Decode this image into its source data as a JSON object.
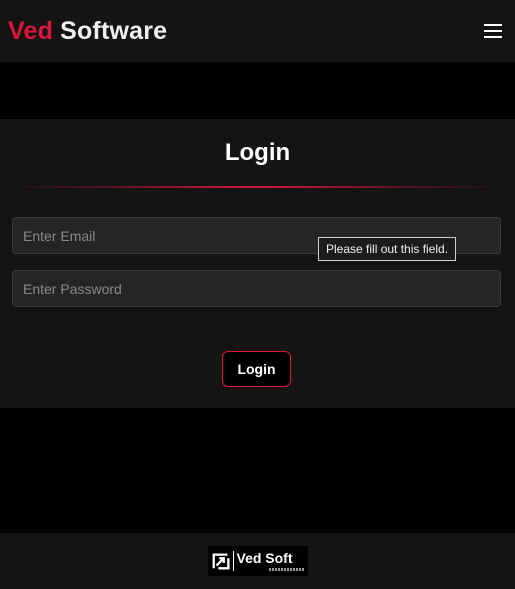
{
  "header": {
    "brand_accent": "Ved",
    "brand_main": "Software",
    "menu_icon": "hamburger-menu-icon"
  },
  "login": {
    "title": "Login",
    "email_placeholder": "Enter Email",
    "password_placeholder": "Enter Password",
    "validation_tooltip": "Please fill out this field.",
    "submit_label": "Login"
  },
  "footer": {
    "logo_name": "Ved Soft",
    "logo_icon": "ved-soft-logo-icon"
  },
  "colors": {
    "accent": "#dc143c",
    "background": "#000000",
    "panel": "#141414",
    "input_bg": "#252525"
  }
}
